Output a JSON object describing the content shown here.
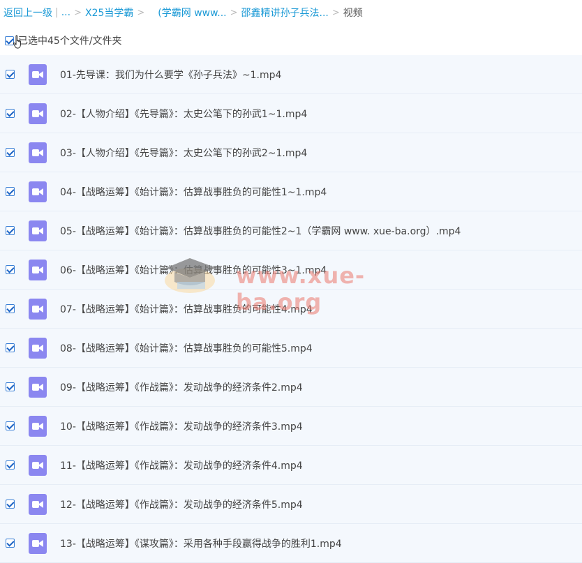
{
  "breadcrumb": {
    "back": "返回上一级",
    "pipe": "|",
    "ellipsis": "...",
    "sep": ">",
    "level1": "X25当学霸",
    "level2": "(学霸网 www...",
    "level3": "邵鑫精讲孙子兵法...",
    "current": "视频"
  },
  "selection": {
    "text": "已选中45个文件/文件夹",
    "checked": true
  },
  "files": [
    {
      "name": "01-先导课：我们为什么要学《孙子兵法》~1.mp4",
      "checked": true
    },
    {
      "name": "02-【人物介绍】《先导篇》：太史公笔下的孙武1~1.mp4",
      "checked": true
    },
    {
      "name": "03-【人物介绍】《先导篇》：太史公笔下的孙武2~1.mp4",
      "checked": true
    },
    {
      "name": "04-【战略运筹】《始计篇》：估算战事胜负的可能性1~1.mp4",
      "checked": true
    },
    {
      "name": "05-【战略运筹】《始计篇》：估算战事胜负的可能性2~1（学霸网 www. xue-ba.org）.mp4",
      "checked": true
    },
    {
      "name": "06-【战略运筹】《始计篇》：估算战事胜负的可能性3~1.mp4",
      "checked": true
    },
    {
      "name": "07-【战略运筹】《始计篇》：估算战事胜负的可能性4.mp4",
      "checked": true
    },
    {
      "name": "08-【战略运筹】《始计篇》：估算战事胜负的可能性5.mp4",
      "checked": true
    },
    {
      "name": "09-【战略运筹】《作战篇》：发动战争的经济条件2.mp4",
      "checked": true
    },
    {
      "name": "10-【战略运筹】《作战篇》：发动战争的经济条件3.mp4",
      "checked": true
    },
    {
      "name": "11-【战略运筹】《作战篇》：发动战争的经济条件4.mp4",
      "checked": true
    },
    {
      "name": "12-【战略运筹】《作战篇》：发动战争的经济条件5.mp4",
      "checked": true
    },
    {
      "name": "13-【战略运筹】《谋攻篇》：采用各种手段赢得战争的胜利1.mp4",
      "checked": true
    }
  ],
  "watermark": {
    "text": "www.xue-ba.org"
  },
  "colors": {
    "link": "#1c9ad6",
    "video_icon": "#8b87f0",
    "row_bg": "#f4f8fd"
  },
  "icons": {
    "file": "video-file-icon",
    "cursor": "hand-cursor-icon"
  }
}
